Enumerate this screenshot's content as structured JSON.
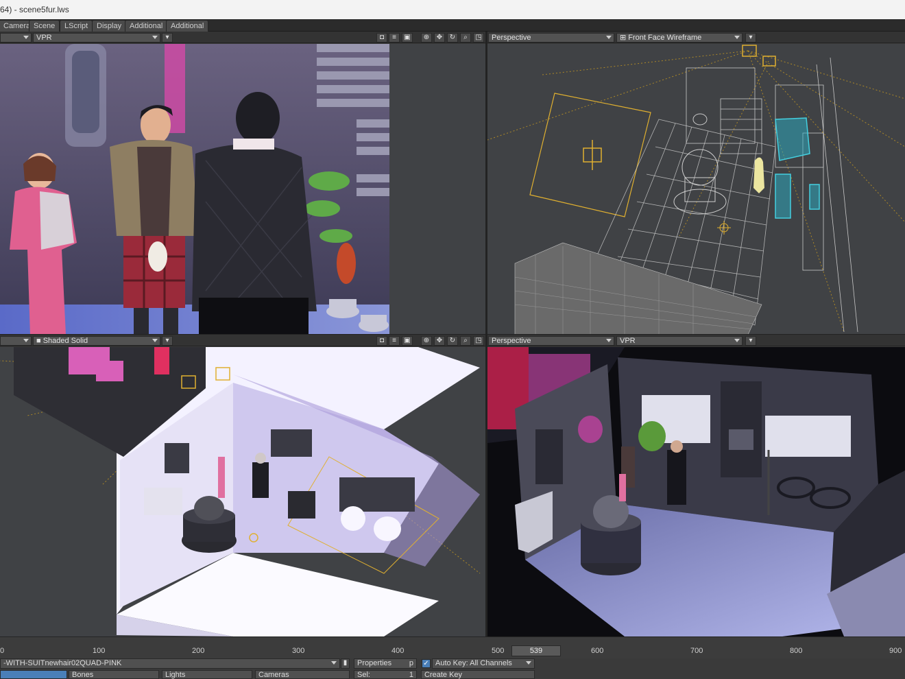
{
  "window": {
    "title": "64) - scene5fur.lws"
  },
  "menu_tabs": [
    "Camera",
    "Scene",
    "LScript",
    "Display",
    "Additional",
    "Additional"
  ],
  "viewports": {
    "top_left": {
      "mode": "VPR"
    },
    "top_right": {
      "view": "Perspective",
      "mode": "Front Face Wireframe"
    },
    "bottom_left": {
      "mode": "Shaded Solid"
    },
    "bottom_right": {
      "view": "Perspective",
      "mode": "VPR"
    }
  },
  "timeline": {
    "labels": [
      "0",
      "100",
      "200",
      "300",
      "400",
      "500",
      "600",
      "700",
      "800",
      "900"
    ],
    "current_frame": "539"
  },
  "bottom": {
    "item_name": "-WITH-SUITnewhair02QUAD-PINK",
    "properties_label": "Properties",
    "properties_key": "p",
    "auto_key_label": "Auto Key: All Channels",
    "bones_label": "Bones",
    "lights_label": "Lights",
    "cameras_label": "Cameras",
    "sel_label": "Sel:",
    "sel_value": "1",
    "create_key_label": "Create Key"
  },
  "colors": {
    "ui_bg": "#3a3a3a",
    "viewport_bg": "#404245",
    "light_gizmo": "#e0b030",
    "selected_wire": "#44d0e0",
    "wire": "#c8c8c8"
  }
}
